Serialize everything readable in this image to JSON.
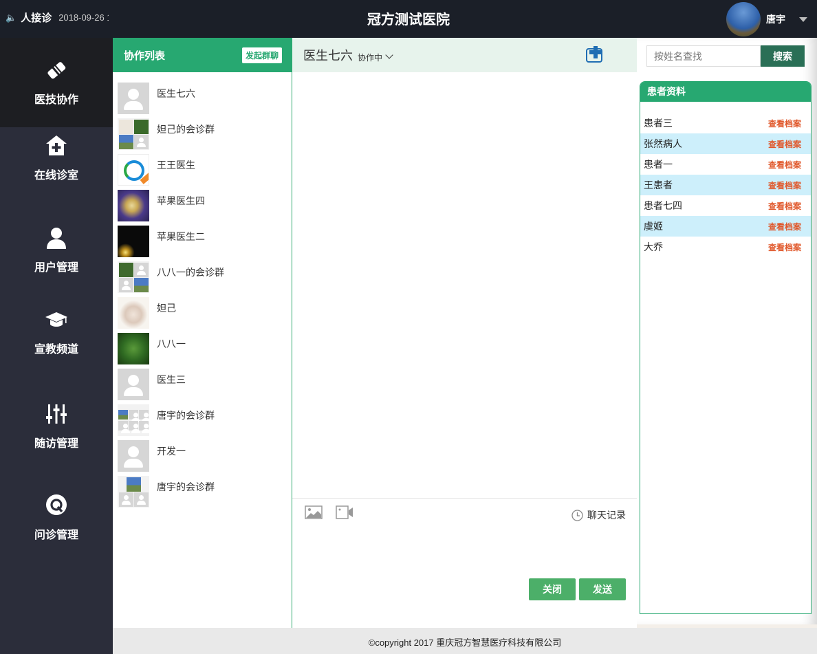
{
  "topbar": {
    "notice_title": "人接诊",
    "notice_date": "2018-09-26 1",
    "hospital_name": "冠方测试医院",
    "user_name": "唐宇"
  },
  "sidenav": {
    "items": [
      {
        "label": "医技协作",
        "icon": "handshake-icon",
        "active": true
      },
      {
        "label": "在线诊室",
        "icon": "clinic-icon"
      },
      {
        "label": "用户管理",
        "icon": "user-icon"
      },
      {
        "label": "宣教频道",
        "icon": "graduation-cap-icon"
      },
      {
        "label": "随访管理",
        "icon": "sliders-icon"
      },
      {
        "label": "问诊管理",
        "icon": "q-chat-icon"
      }
    ]
  },
  "collab": {
    "title": "协作列表",
    "group_chat_button": "发起群聊",
    "contacts": [
      {
        "name": "医生七六",
        "avatar": "default"
      },
      {
        "name": "妲己的会诊群",
        "avatar": "group"
      },
      {
        "name": "王王医生",
        "avatar": "logo"
      },
      {
        "name": "苹果医生四",
        "avatar": "photo"
      },
      {
        "name": "苹果医生二",
        "avatar": "photo"
      },
      {
        "name": "八八一的会诊群",
        "avatar": "group"
      },
      {
        "name": "妲己",
        "avatar": "photo"
      },
      {
        "name": "八八一",
        "avatar": "photo"
      },
      {
        "name": "医生三",
        "avatar": "default"
      },
      {
        "name": "唐宇的会诊群",
        "avatar": "group"
      },
      {
        "name": "开发一",
        "avatar": "default"
      },
      {
        "name": "唐宇的会诊群",
        "avatar": "group"
      }
    ]
  },
  "chat": {
    "contact_name": "医生七六",
    "status": "协作中",
    "history_label": "聊天记录",
    "close_button": "关闭",
    "send_button": "发送"
  },
  "patients": {
    "search_placeholder": "按姓名查找",
    "search_button": "搜索",
    "panel_title": "患者资料",
    "rows": [
      {
        "name": "患者三",
        "action": "查看档案"
      },
      {
        "name": "张然病人",
        "action": "查看档案"
      },
      {
        "name": "患者一",
        "action": "查看档案"
      },
      {
        "name": "王患者",
        "action": "查看档案"
      },
      {
        "name": "患者七四",
        "action": "查看档案"
      },
      {
        "name": "虞姬",
        "action": "查看档案"
      },
      {
        "name": "大乔",
        "action": "查看档案"
      }
    ]
  },
  "footer": {
    "copyright": "©copyright 2017 重庆冠方智慧医疗科技有限公司"
  },
  "colors": {
    "accent_green": "#27a871",
    "dark_nav": "#2b2d3a",
    "link_orange": "#e0572a",
    "search_button": "#2a6f56"
  }
}
